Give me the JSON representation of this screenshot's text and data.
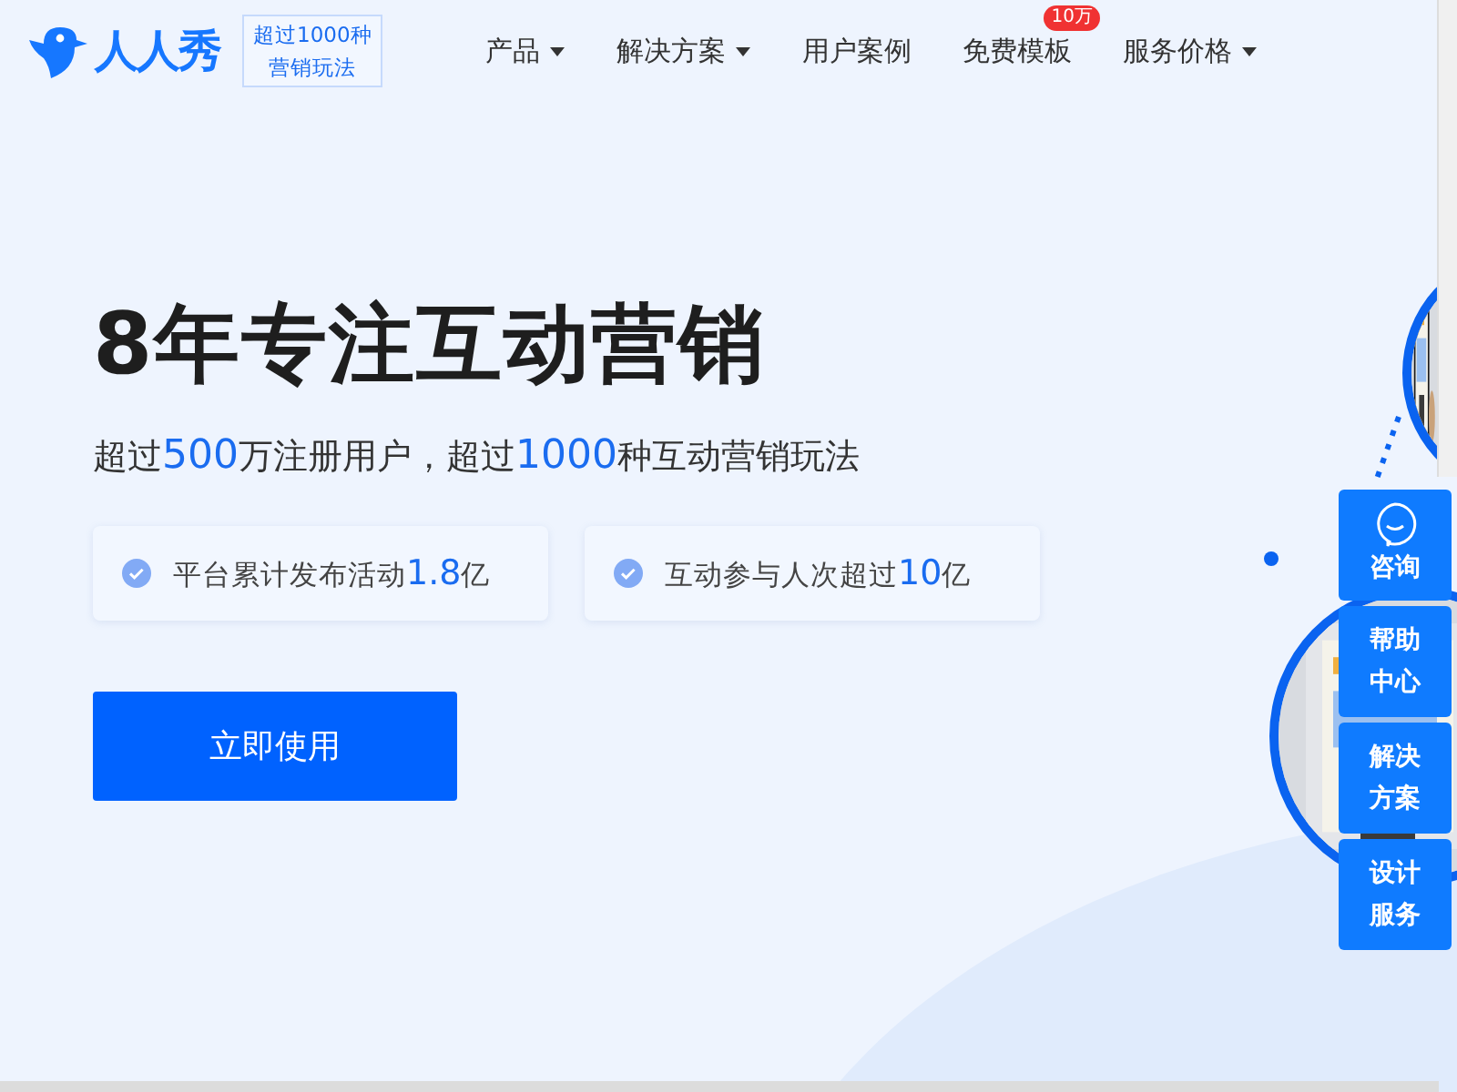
{
  "header": {
    "logo": "人人秀",
    "tagline": [
      "超过1000种",
      "营销玩法"
    ],
    "nav": [
      {
        "label": "产品",
        "dropdown": true
      },
      {
        "label": "解决方案",
        "dropdown": true
      },
      {
        "label": "用户案例",
        "dropdown": false
      },
      {
        "label": "免费模板",
        "dropdown": false,
        "badge": "10万"
      },
      {
        "label": "服务价格",
        "dropdown": true
      }
    ]
  },
  "hero": {
    "title": "8年专注互动营销",
    "subtitle": [
      {
        "text": "超过",
        "highlight": false
      },
      {
        "text": "500",
        "highlight": true
      },
      {
        "text": "万注册用户，超过",
        "highlight": false
      },
      {
        "text": "1000",
        "highlight": true
      },
      {
        "text": "种互动营销玩法",
        "highlight": false
      }
    ],
    "stats": [
      {
        "label": "平台累计发布活动",
        "value": "1.8",
        "unit": "亿"
      },
      {
        "label": "互动参与人次超过",
        "value": "10",
        "unit": "亿"
      }
    ],
    "cta": "立即使用"
  },
  "side_buttons": [
    {
      "kind": "chat",
      "lines": [
        "咨询"
      ]
    },
    {
      "kind": "text",
      "lines": [
        "帮助",
        "中心"
      ]
    },
    {
      "kind": "text",
      "lines": [
        "解决",
        "方案"
      ]
    },
    {
      "kind": "text",
      "lines": [
        "设计",
        "服务"
      ]
    }
  ]
}
